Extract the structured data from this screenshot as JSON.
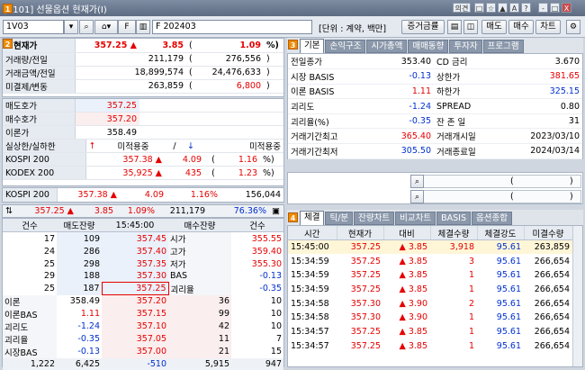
{
  "window": {
    "title": "[5101] 선물옵션 현재가(I)",
    "controls": [
      "의견",
      "□",
      "☆",
      "▲",
      "A",
      "?",
      "-",
      "□",
      "X"
    ]
  },
  "toolbar": {
    "code": "1V03",
    "type": "F",
    "code2": "F 202403",
    "unit": "[단위 : 계약, 백만]",
    "buttons": [
      "증거금률",
      "매도",
      "매수",
      "차트"
    ]
  },
  "badges": [
    "1",
    "2",
    "3",
    "4"
  ],
  "summary": {
    "rows": [
      {
        "label": "현재가",
        "value": "357.25 ▲",
        "change": "3.85",
        "paren_open": "(",
        "pct": "1.09",
        "pct_unit": "%)"
      },
      {
        "label": "거래량/전일",
        "value": "211,179",
        "paren_open": "(",
        "prev": "276,556",
        "paren_close": ")"
      },
      {
        "label": "거래금액/전일",
        "value": "18,899,574",
        "paren_open": "(",
        "prev": "24,476,633",
        "paren_close": ")"
      },
      {
        "label": "미결제/변동",
        "value": "263,859",
        "paren_open": "(",
        "prev": "6,800",
        "paren_close": ")"
      }
    ]
  },
  "quote": {
    "rows": [
      {
        "label": "매도호가",
        "value": "357.25"
      },
      {
        "label": "매수호가",
        "value": "357.20"
      },
      {
        "label": "이론가",
        "value": "358.49"
      }
    ],
    "sub_header": {
      "label": "실상한/실하한",
      "up": "↑",
      "mid": "미적용중",
      "slash": "/",
      "down": "↓",
      "right": "미적용중"
    },
    "indices": [
      {
        "name": "KOSPI 200",
        "value": "357.38 ▲",
        "change": "4.09",
        "paren_open": "(",
        "pct": "1.16",
        "unit": "%)"
      },
      {
        "name": "KODEX 200",
        "value": "35,925 ▲",
        "change": "435",
        "paren_open": "(",
        "pct": "1.23",
        "unit": "%)"
      }
    ]
  },
  "kospi_bar": {
    "name": "KOSPI 200",
    "value": "357.38 ▲",
    "change": "4.09",
    "pct": "1.16%",
    "vol": "156,044"
  },
  "arrow_bar": {
    "price": "357.25 ▲",
    "change": "3.85",
    "pct": "1.09%",
    "vol": "211,179",
    "ratio": "76.36%"
  },
  "hoga": {
    "headers": [
      "건수",
      "매도잔량",
      "15:45:00",
      "매수잔량",
      "건수"
    ],
    "asks": [
      {
        "cnt": "17",
        "qty": "109",
        "price": "357.45"
      },
      {
        "cnt": "24",
        "qty": "286",
        "price": "357.40"
      },
      {
        "cnt": "25",
        "qty": "298",
        "price": "357.35"
      },
      {
        "cnt": "29",
        "qty": "188",
        "price": "357.30"
      },
      {
        "cnt": "25",
        "qty": "187",
        "price": "357.25"
      }
    ],
    "side_info": [
      {
        "label": "시가",
        "value": "355.55"
      },
      {
        "label": "고가",
        "value": "359.40"
      },
      {
        "label": "저가",
        "value": "355.30"
      },
      {
        "label": "BAS",
        "value": "-0.13"
      },
      {
        "label": "괴리율",
        "value": "-0.35"
      }
    ],
    "bids": [
      {
        "label": "이론",
        "lv": "358.49",
        "price": "357.20",
        "qty": "36",
        "cnt": "10"
      },
      {
        "label": "이론BAS",
        "lv": "1.11",
        "price": "357.15",
        "qty": "99",
        "cnt": "10"
      },
      {
        "label": "괴리도",
        "lv": "-1.24",
        "price": "357.10",
        "qty": "42",
        "cnt": "10"
      },
      {
        "label": "괴리율",
        "lv": "-0.35",
        "price": "357.05",
        "qty": "11",
        "cnt": "7"
      },
      {
        "label": "시장BAS",
        "lv": "-0.13",
        "price": "357.00",
        "qty": "21",
        "cnt": "15"
      }
    ],
    "totals": {
      "cnt_ask": "1,222",
      "qty_ask": "6,425",
      "diff": "-510",
      "qty_bid": "5,915",
      "cnt_bid": "947"
    }
  },
  "tabs3": [
    "기본",
    "손익구조",
    "시가총액",
    "매매동향",
    "투자자",
    "프로그램"
  ],
  "info": {
    "rows": [
      {
        "l1": "전일종가",
        "v1": "353.40",
        "l2": "CD 금리",
        "v2": "3.670"
      },
      {
        "l1": "시장 BASIS",
        "v1": "-0.13",
        "l2": "상한가",
        "v2": "381.65"
      },
      {
        "l1": "이론 BASIS",
        "v1": "1.11",
        "l2": "하한가",
        "v2": "325.15"
      },
      {
        "l1": "괴리도",
        "v1": "-1.24",
        "l2": "SPREAD",
        "v2": "0.80"
      },
      {
        "l1": "괴리율(%)",
        "v1": "-0.35",
        "l2": "잔 존 일",
        "v2": "31"
      },
      {
        "l1": "거래기간최고",
        "v1": "365.40",
        "l2": "거래개시일",
        "v2": "2023/03/10"
      },
      {
        "l1": "거래기간최저",
        "v1": "305.50",
        "l2": "거래종료일",
        "v2": "2024/03/14"
      }
    ]
  },
  "search_rows": [
    {
      "paren": "(",
      "close": ")"
    },
    {
      "paren": "(",
      "close": ")"
    }
  ],
  "tabs4": [
    "체결",
    "틱/분",
    "잔량차트",
    "비교차트",
    "BASIS",
    "옵션종합"
  ],
  "tick": {
    "headers": [
      "시간",
      "현재가",
      "대비",
      "체결수량",
      "체결강도",
      "미결수량"
    ],
    "rows": [
      {
        "t": "15:45:00",
        "p": "357.25",
        "d": "▲ 3.85",
        "q": "3,918",
        "s": "95.61",
        "o": "263,859"
      },
      {
        "t": "15:34:59",
        "p": "357.25",
        "d": "▲ 3.85",
        "q": "3",
        "s": "95.61",
        "o": "266,654"
      },
      {
        "t": "15:34:59",
        "p": "357.25",
        "d": "▲ 3.85",
        "q": "1",
        "s": "95.61",
        "o": "266,654"
      },
      {
        "t": "15:34:59",
        "p": "357.25",
        "d": "▲ 3.85",
        "q": "1",
        "s": "95.61",
        "o": "266,654"
      },
      {
        "t": "15:34:58",
        "p": "357.30",
        "d": "▲ 3.90",
        "q": "2",
        "s": "95.61",
        "o": "266,654"
      },
      {
        "t": "15:34:58",
        "p": "357.30",
        "d": "▲ 3.90",
        "q": "1",
        "s": "95.61",
        "o": "266,654"
      },
      {
        "t": "15:34:57",
        "p": "357.25",
        "d": "▲ 3.85",
        "q": "1",
        "s": "95.61",
        "o": "266,654"
      },
      {
        "t": "15:34:57",
        "p": "357.25",
        "d": "▲ 3.85",
        "q": "1",
        "s": "95.61",
        "o": "266,654"
      }
    ]
  }
}
